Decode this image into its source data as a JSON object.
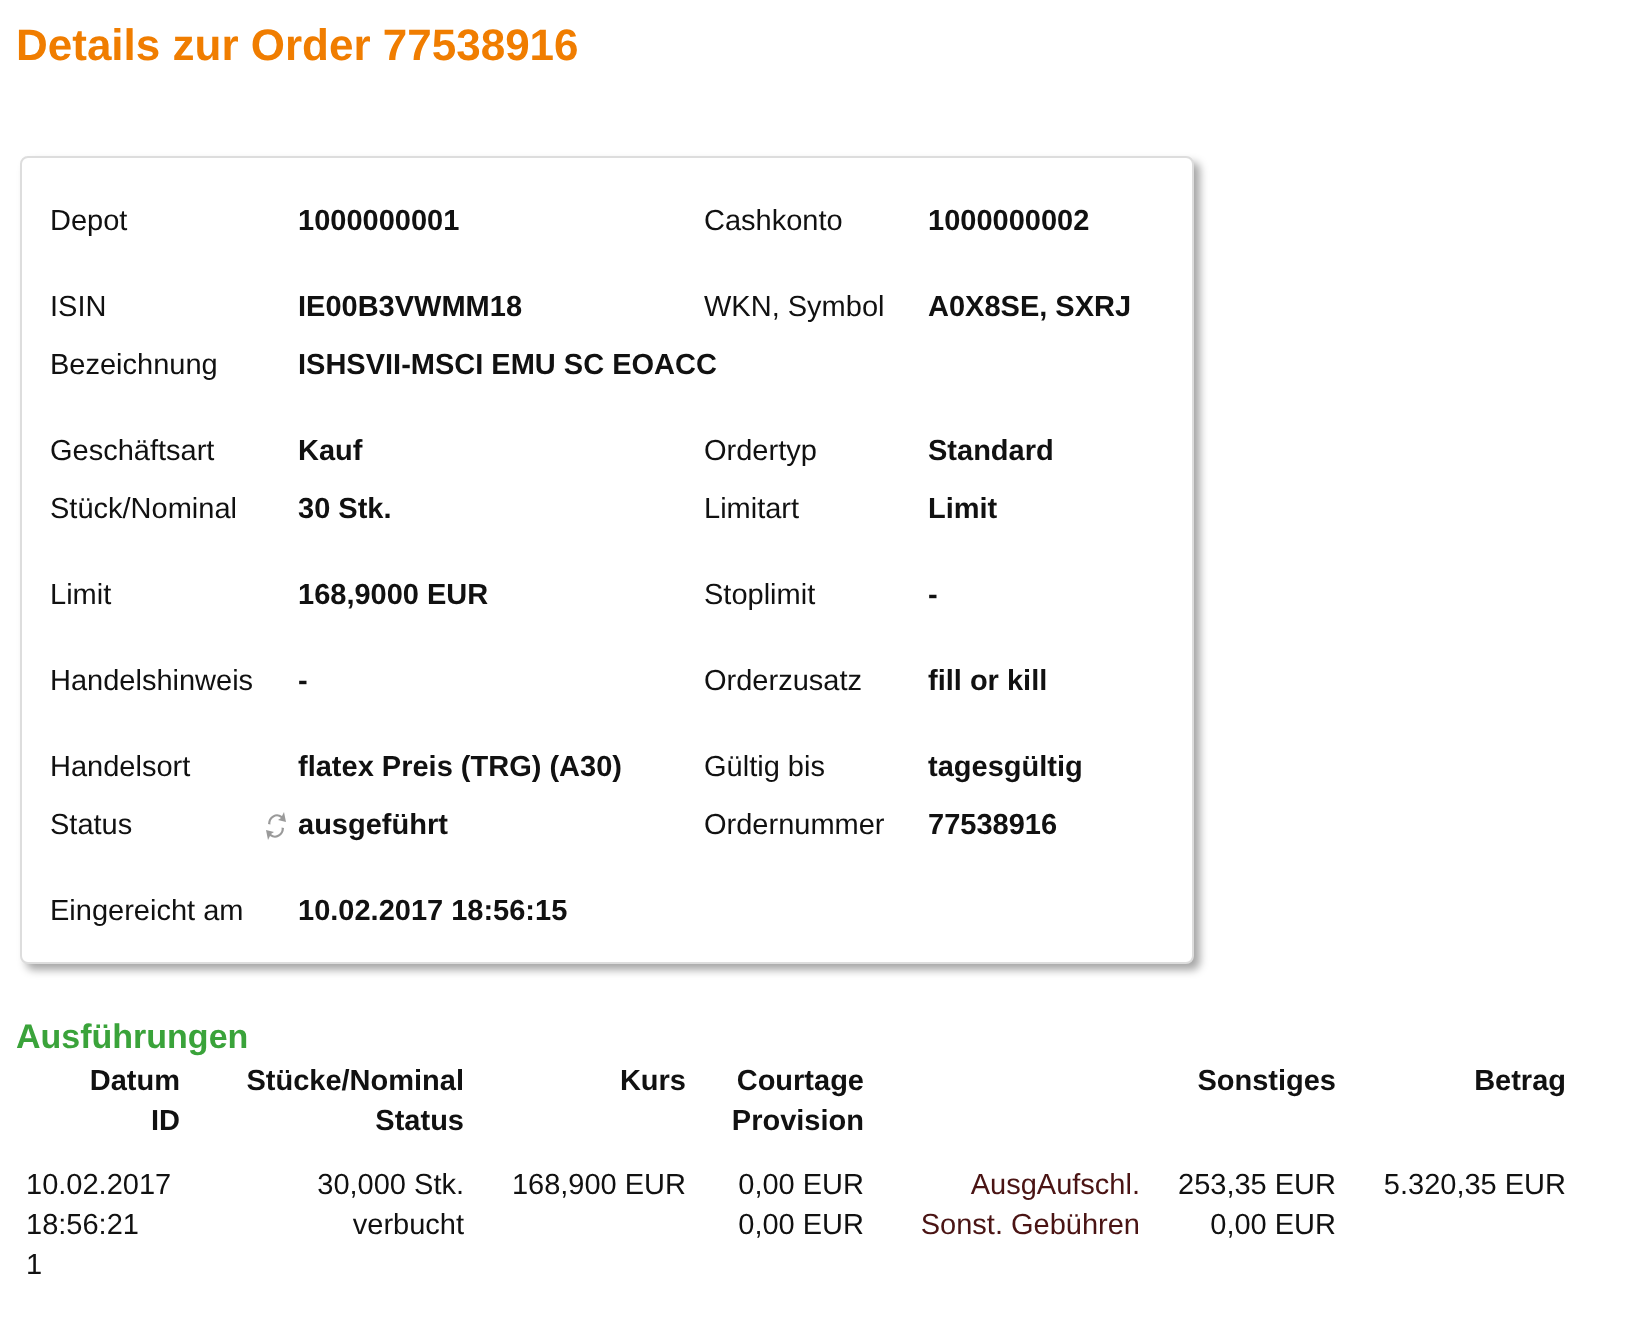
{
  "title": "Details zur Order 77538916",
  "details": [
    {
      "rows": [
        {
          "cells": [
            {
              "label": "Depot",
              "value": "1000000001"
            },
            {
              "label": "Cashkonto",
              "value": "1000000002"
            }
          ]
        }
      ]
    },
    {
      "rows": [
        {
          "cells": [
            {
              "label": "ISIN",
              "value": "IE00B3VWMM18"
            },
            {
              "label": "WKN, Symbol",
              "value": "A0X8SE, SXRJ"
            }
          ]
        },
        {
          "cells": [
            {
              "label": "Bezeichnung",
              "value": "ISHSVII-MSCI EMU SC EOACC"
            }
          ]
        }
      ]
    },
    {
      "rows": [
        {
          "cells": [
            {
              "label": "Geschäftsart",
              "value": "Kauf"
            },
            {
              "label": "Ordertyp",
              "value": "Standard"
            }
          ]
        },
        {
          "cells": [
            {
              "label": "Stück/Nominal",
              "value": "30 Stk."
            },
            {
              "label": "Limitart",
              "value": "Limit"
            }
          ]
        }
      ]
    },
    {
      "rows": [
        {
          "cells": [
            {
              "label": "Limit",
              "value": "168,9000 EUR"
            },
            {
              "label": "Stoplimit",
              "value": "-"
            }
          ]
        }
      ]
    },
    {
      "rows": [
        {
          "cells": [
            {
              "label": "Handelshinweis",
              "value": "-"
            },
            {
              "label": "Orderzusatz",
              "value": "fill or kill"
            }
          ]
        }
      ]
    },
    {
      "rows": [
        {
          "cells": [
            {
              "label": "Handelsort",
              "value": "flatex Preis (TRG) (A30)"
            },
            {
              "label": "Gültig bis",
              "value": "tagesgültig"
            }
          ]
        },
        {
          "cells": [
            {
              "label": "Status",
              "value": "ausgeführt",
              "kind": "status"
            },
            {
              "label": "Ordernummer",
              "value": "77538916"
            }
          ]
        }
      ]
    },
    {
      "rows": [
        {
          "cells": [
            {
              "label": "Eingereicht am",
              "value": "10.02.2017 18:56:15"
            }
          ]
        }
      ]
    }
  ],
  "executions": {
    "title": "Ausführungen",
    "columns": [
      {
        "lines": [
          "Datum",
          "ID"
        ]
      },
      {
        "lines": [
          "Stücke/Nominal",
          "Status"
        ]
      },
      {
        "lines": [
          "Kurs"
        ]
      },
      {
        "lines": [
          "Courtage",
          "Provision"
        ]
      },
      {},
      {
        "lines": [
          "Sonstiges"
        ]
      },
      {
        "lines": [
          "Betrag"
        ]
      }
    ],
    "rows": [
      {
        "cells": [
          [
            "10.02.2017",
            "18:56:21",
            "1"
          ],
          [
            "30,000 Stk.",
            "verbucht"
          ],
          [
            "168,900 EUR"
          ],
          [
            "0,00 EUR",
            "0,00 EUR"
          ],
          [
            "AusgAufschl.",
            "Sonst. Gebühren"
          ],
          [
            "253,35 EUR",
            "0,00 EUR"
          ],
          [
            "5.320,35 EUR"
          ]
        ]
      }
    ]
  }
}
